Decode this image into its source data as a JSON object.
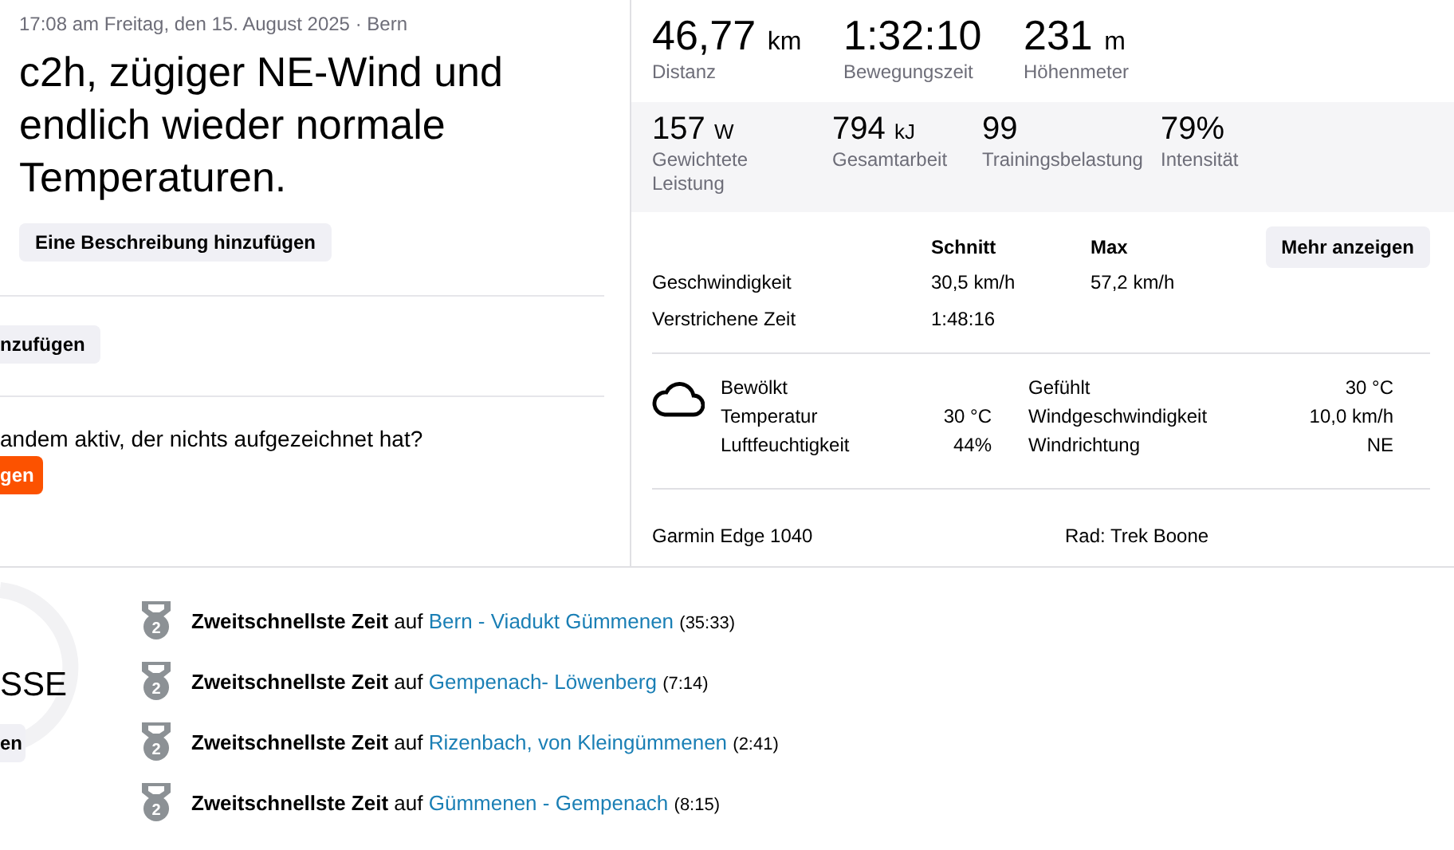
{
  "activity": {
    "meta": "17:08 am Freitag, den 15. August 2025 · Bern",
    "title": "c2h, zügiger NE-Wind und endlich wieder normale Temperaturen.",
    "description_button": "Eine Beschreibung hinzufügen"
  },
  "left_cut": {
    "button": "nzufügen",
    "question": "andem aktiv, der nichts aufgezeichnet hat?",
    "action_button": "gen"
  },
  "primary_stats": [
    {
      "value": "46,77",
      "unit": "km",
      "label": "Distanz"
    },
    {
      "value": "1:32:10",
      "label": "Bewegungszeit"
    },
    {
      "value": "231",
      "unit": "m",
      "label": "Höhenmeter"
    }
  ],
  "secondary_stats": [
    {
      "value": "157",
      "unit": "W",
      "label": "Gewichtete Leistung"
    },
    {
      "value": "794",
      "unit": "kJ",
      "label": "Gesamtarbeit"
    },
    {
      "value": "99",
      "label": "Trainingsbelastung"
    },
    {
      "value": "79%",
      "label": "Intensität"
    }
  ],
  "stats_table": {
    "columns": [
      "Schnitt",
      "Max"
    ],
    "more_button": "Mehr anzeigen",
    "rows": [
      {
        "label": "Geschwindigkeit",
        "avg": "30,5 km/h",
        "max": "57,2 km/h"
      },
      {
        "label": "Verstrichene Zeit",
        "avg": "1:48:16"
      }
    ]
  },
  "weather": {
    "condition": "Bewölkt",
    "left": [
      {
        "label": "Temperatur",
        "value": "30 °C"
      },
      {
        "label": "Luftfeuchtigkeit",
        "value": "44%"
      }
    ],
    "right": [
      {
        "label": "Gefühlt",
        "value": "30 °C"
      },
      {
        "label": "Windgeschwindigkeit",
        "value": "10,0 km/h"
      },
      {
        "label": "Windrichtung",
        "value": "NE"
      }
    ]
  },
  "devices": {
    "device": "Garmin Edge 1040",
    "bike": "Rad: Trek Boone"
  },
  "achievements_cut": {
    "title": "SSE",
    "button": "en"
  },
  "achievements": [
    {
      "prefix": "**Zweitschnellste Zeit** auf",
      "segment": "Bern - Viadukt Gümmenen",
      "time": "(35:33)",
      "rank": "2"
    },
    {
      "prefix": "**Zweitschnellste Zeit** auf",
      "segment": "Gempenach- Löwenberg",
      "time": "(7:14)",
      "rank": "2"
    },
    {
      "prefix": "**Zweitschnellste Zeit** auf",
      "segment": "Rizenbach, von Kleingümmenen",
      "time": "(2:41)",
      "rank": "2"
    },
    {
      "prefix": "**Zweitschnellste Zeit** auf",
      "segment": "Gümmenen - Gempenach",
      "time": "(8:15)",
      "rank": "2"
    }
  ]
}
